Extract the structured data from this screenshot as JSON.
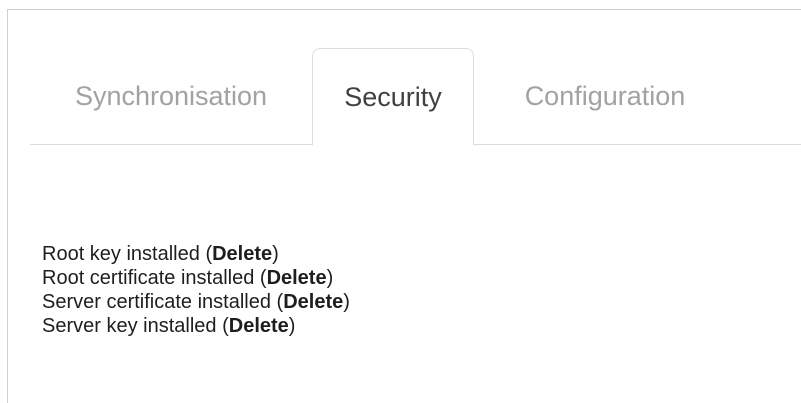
{
  "tabs": [
    {
      "label": "Synchronisation",
      "active": false
    },
    {
      "label": "Security",
      "active": true
    },
    {
      "label": "Configuration",
      "active": false
    }
  ],
  "security": {
    "items": [
      {
        "text": "Root key installed",
        "open_paren": "(",
        "action": "Delete",
        "close_paren": ")"
      },
      {
        "text": "Root certificate installed",
        "open_paren": "(",
        "action": "Delete",
        "close_paren": ")"
      },
      {
        "text": "Server certificate installed",
        "open_paren": "(",
        "action": "Delete",
        "close_paren": ")"
      },
      {
        "text": "Server key installed",
        "open_paren": "(",
        "action": "Delete",
        "close_paren": ")"
      }
    ]
  },
  "colors": {
    "tab_inactive": "#a2a2a2",
    "tab_active": "#404040",
    "text": "#1e1e1e",
    "border": "#dddddd"
  }
}
